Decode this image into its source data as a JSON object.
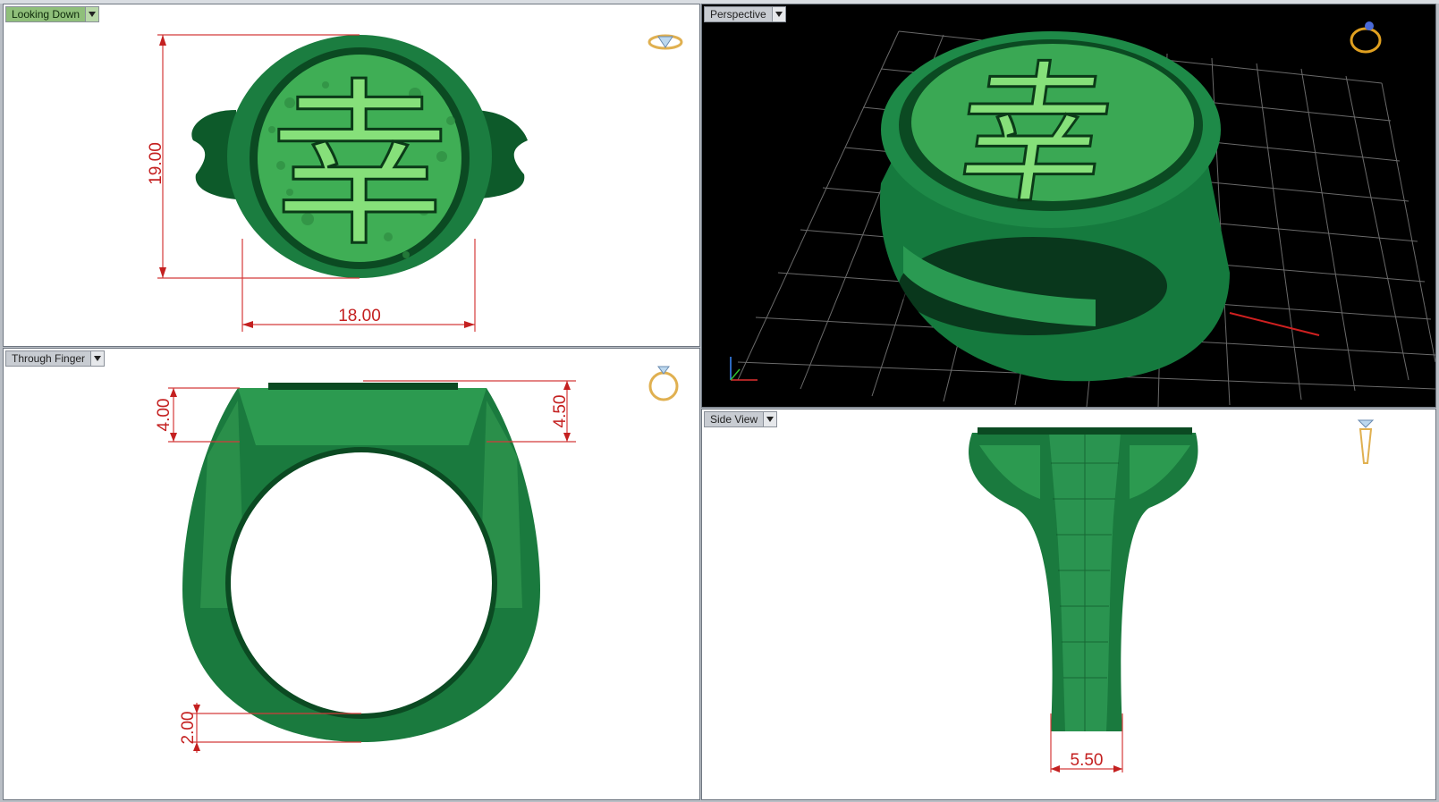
{
  "viewports": {
    "top_left": {
      "label": "Looking Down",
      "active": true,
      "dims": {
        "height": "19.00",
        "width": "18.00"
      },
      "character": "幸"
    },
    "top_right": {
      "label": "Perspective",
      "active": false,
      "character": "幸"
    },
    "bottom_left": {
      "label": "Through Finger",
      "active": false,
      "dims": {
        "left_height": "4.00",
        "right_height": "4.50",
        "shank": "2.00"
      }
    },
    "bottom_right": {
      "label": "Side View",
      "active": false,
      "dims": {
        "base_width": "5.50"
      }
    }
  },
  "colors": {
    "ring_green": "#1f8c4a",
    "ring_dark": "#0b4a22",
    "character_green": "#86e07a",
    "dimension_red": "#c42020"
  },
  "icons": [
    "ring-diamond-icon",
    "ring-perspective-icon",
    "ring-front-icon",
    "ring-side-icon",
    "axis-icon"
  ]
}
